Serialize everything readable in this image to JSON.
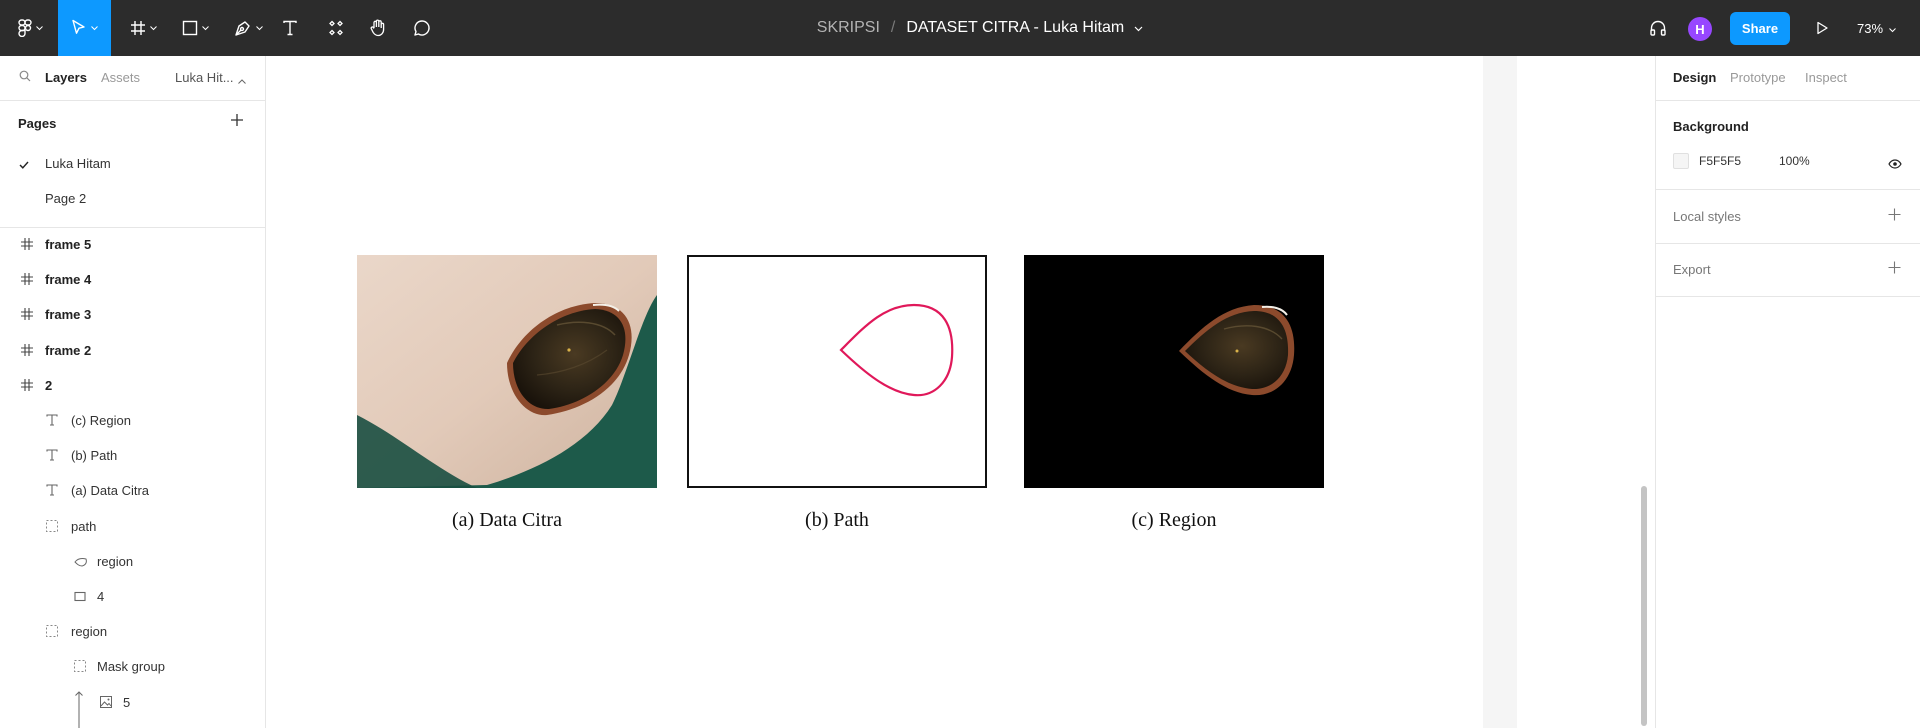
{
  "toolbar": {
    "project_name": "SKRIPSI",
    "separator": "/",
    "file_name": "DATASET CITRA - Luka Hitam",
    "avatar_initial": "H",
    "share_label": "Share",
    "zoom": "73%",
    "tools": [
      "figma-menu-icon",
      "move-tool-icon",
      "frame-tool-icon",
      "shape-tool-icon",
      "pen-tool-icon",
      "text-tool-icon",
      "components-icon",
      "hand-tool-icon",
      "comment-icon"
    ],
    "active_color": "#0d99ff"
  },
  "left_panel": {
    "tabs": {
      "layers": "Layers",
      "assets": "Assets",
      "page": "Luka Hit..."
    },
    "pages_heading": "Pages",
    "pages": [
      {
        "label": "Luka Hitam",
        "selected": true
      },
      {
        "label": "Page 2",
        "selected": false
      }
    ],
    "layers": [
      {
        "label": "frame 5",
        "icon": "frame-icon"
      },
      {
        "label": "frame 4",
        "icon": "frame-icon"
      },
      {
        "label": "frame 3",
        "icon": "frame-icon"
      },
      {
        "label": "frame 2",
        "icon": "frame-icon"
      },
      {
        "label": "2",
        "icon": "frame-icon"
      },
      {
        "label": "(c) Region",
        "icon": "text-icon"
      },
      {
        "label": "(b) Path",
        "icon": "text-icon"
      },
      {
        "label": "(a) Data Citra",
        "icon": "text-icon"
      },
      {
        "label": "path",
        "icon": "group-icon"
      },
      {
        "label": "region",
        "icon": "vector-icon"
      },
      {
        "label": "4",
        "icon": "rectangle-icon"
      },
      {
        "label": "region",
        "icon": "group-icon"
      },
      {
        "label": "Mask group",
        "icon": "group-icon"
      },
      {
        "label": "5",
        "icon": "image-icon"
      }
    ]
  },
  "canvas": {
    "captions": [
      "(a) Data Citra",
      "(b) Path",
      "(c) Region"
    ],
    "path_stroke_color": "#e0185a"
  },
  "right_panel": {
    "tabs": {
      "design": "Design",
      "prototype": "Prototype",
      "inspect": "Inspect"
    },
    "background_label": "Background",
    "background_hex": "F5F5F5",
    "background_opacity": "100%",
    "local_styles_label": "Local styles",
    "export_label": "Export"
  }
}
